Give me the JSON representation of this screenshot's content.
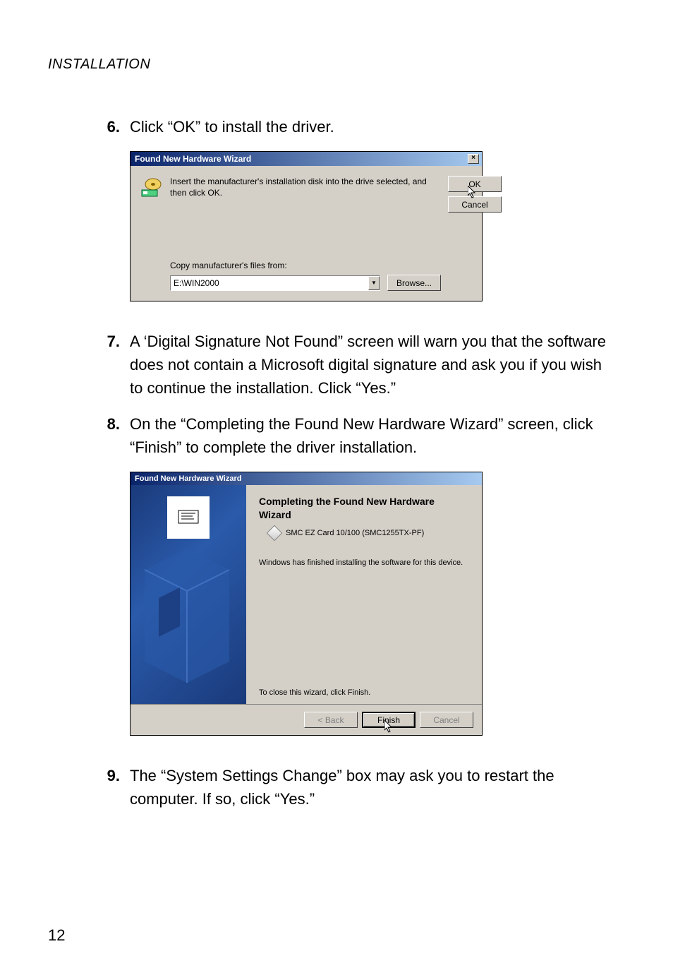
{
  "header": "INSTALLATION",
  "steps": {
    "s6": {
      "num": "6.",
      "text": "Click “OK” to install the driver."
    },
    "s7": {
      "num": "7.",
      "text": "A ‘Digital Signature Not Found” screen will warn you that the software does not contain a Microsoft digital signature and ask you if you wish to continue the installation. Click “Yes.”"
    },
    "s8": {
      "num": "8.",
      "text": "On the “Completing the Found New Hardware Wizard” screen, click “Finish” to complete the driver installation."
    },
    "s9": {
      "num": "9.",
      "text": "The “System Settings Change” box may ask you to restart the computer. If so, click “Yes.”"
    }
  },
  "dialog1": {
    "title": "Found New Hardware Wizard",
    "close_x": "×",
    "instruction": "Insert the manufacturer's installation disk into the drive selected, and then click OK.",
    "ok": "OK",
    "cancel": "Cancel",
    "copy_label": "Copy manufacturer's files from:",
    "path": "E:\\WIN2000",
    "browse": "Browse..."
  },
  "dialog2": {
    "title": "Found New Hardware Wizard",
    "heading": "Completing the Found New Hardware Wizard",
    "device": "SMC EZ Card 10/100 (SMC1255TX-PF)",
    "finished": "Windows has finished installing the software for this device.",
    "close_hint": "To close this wizard, click Finish.",
    "back": "< Back",
    "finish": "Finish",
    "cancel": "Cancel"
  },
  "page_number": "12"
}
